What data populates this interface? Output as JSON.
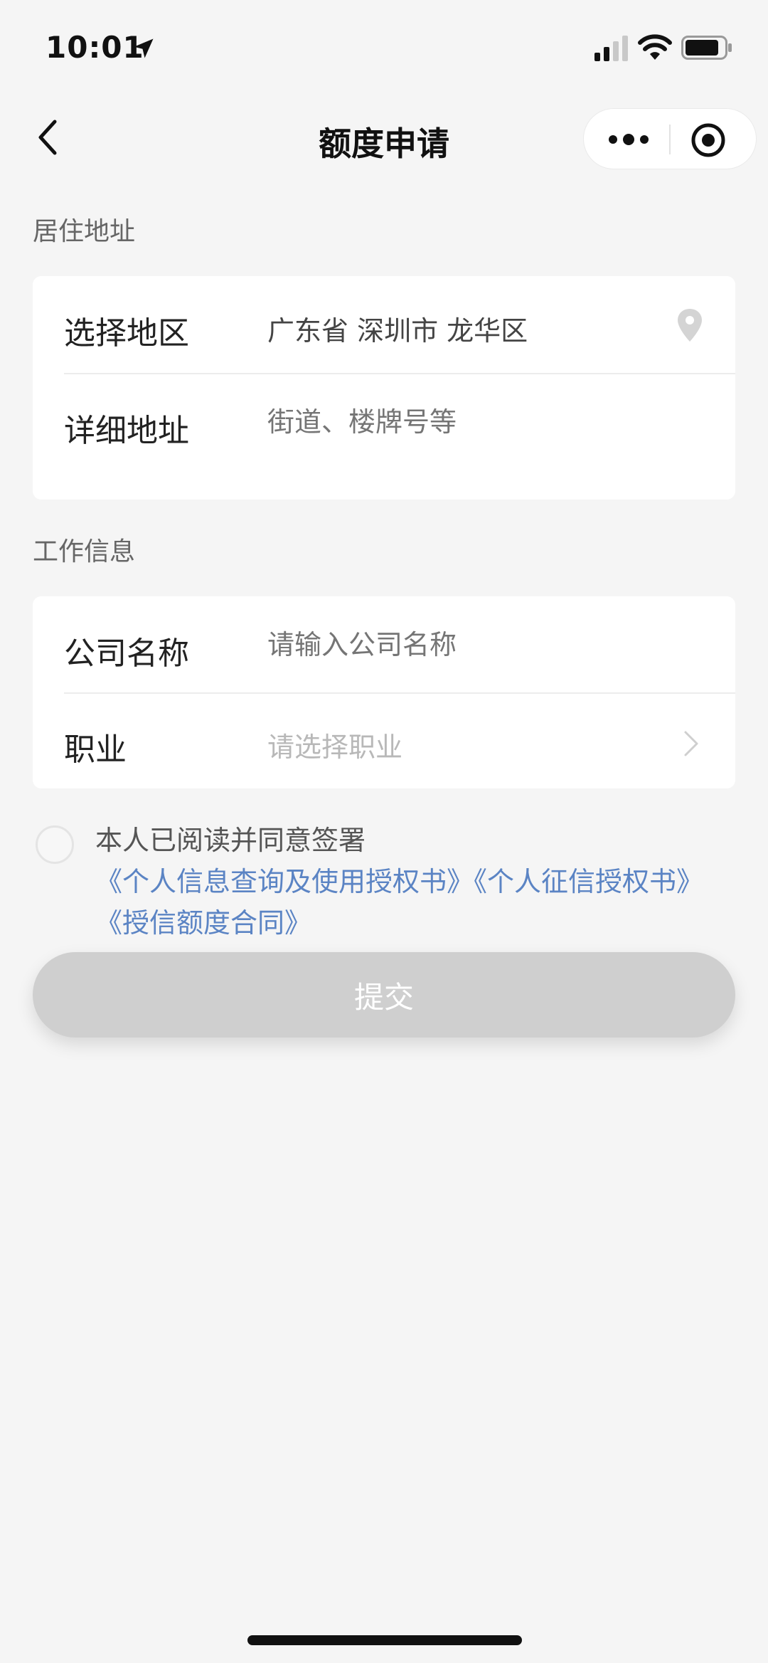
{
  "status_bar": {
    "time": "10:01"
  },
  "nav": {
    "title": "额度申请"
  },
  "residence": {
    "section_title": "居住地址",
    "region_label": "选择地区",
    "region_value": "广东省 深圳市 龙华区",
    "address_label": "详细地址",
    "address_placeholder": "街道、楼牌号等"
  },
  "work": {
    "section_title": "工作信息",
    "company_label": "公司名称",
    "company_placeholder": "请输入公司名称",
    "job_label": "职业",
    "job_placeholder": "请选择职业"
  },
  "agreement": {
    "prefix": "本人已阅读并同意签署",
    "link1": "《个人信息查询及使用授权书》",
    "link2": "《个人征信授权书》",
    "link3": "《授信额度合同》",
    "checked": false
  },
  "submit": {
    "label": "提交"
  },
  "colors": {
    "background": "#f5f5f5",
    "link": "#5b84c4",
    "button_disabled": "#cfcfcf",
    "placeholder": "#b8b8b8"
  }
}
